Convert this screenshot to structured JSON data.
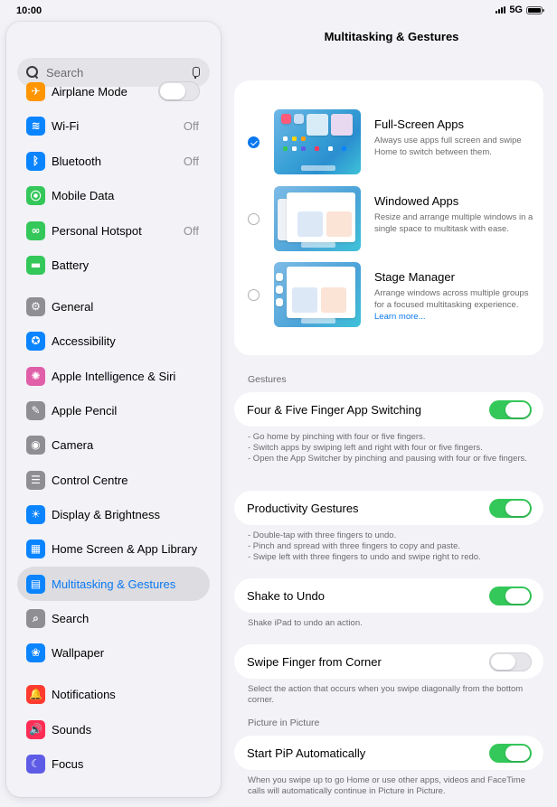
{
  "status_bar": {
    "time": "10:00",
    "network": "5G"
  },
  "sidebar": {
    "search_placeholder": "Search",
    "items": [
      {
        "label": "Airplane Mode",
        "icon": "airplane-icon",
        "color": "#ff9500",
        "glyph": "✈",
        "toggle": false,
        "value": ""
      },
      {
        "label": "Wi-Fi",
        "icon": "wifi-icon",
        "color": "#0a84ff",
        "glyph": "≋",
        "value": "Off"
      },
      {
        "label": "Bluetooth",
        "icon": "bluetooth-icon",
        "color": "#0a84ff",
        "glyph": "ᛒ",
        "value": "Off"
      },
      {
        "label": "Mobile Data",
        "icon": "antenna-icon",
        "color": "#34c759",
        "glyph": "⦿",
        "value": ""
      },
      {
        "label": "Personal Hotspot",
        "icon": "hotspot-icon",
        "color": "#34c759",
        "glyph": "∞",
        "value": "Off"
      },
      {
        "label": "Battery",
        "icon": "battery-icon",
        "color": "#34c759",
        "glyph": "▬",
        "value": ""
      },
      {
        "label": "General",
        "icon": "gear-icon",
        "color": "#8e8e93",
        "glyph": "⚙",
        "value": ""
      },
      {
        "label": "Accessibility",
        "icon": "accessibility-icon",
        "color": "#0a84ff",
        "glyph": "✪",
        "value": ""
      },
      {
        "label": "Apple Intelligence & Siri",
        "icon": "siri-icon",
        "color": "#e05fa8",
        "glyph": "✺",
        "value": ""
      },
      {
        "label": "Apple Pencil",
        "icon": "pencil-icon",
        "color": "#8e8e93",
        "glyph": "✎",
        "value": ""
      },
      {
        "label": "Camera",
        "icon": "camera-icon",
        "color": "#8e8e93",
        "glyph": "◉",
        "value": ""
      },
      {
        "label": "Control Centre",
        "icon": "control-centre-icon",
        "color": "#8e8e93",
        "glyph": "☰",
        "value": ""
      },
      {
        "label": "Display & Brightness",
        "icon": "brightness-icon",
        "color": "#0a84ff",
        "glyph": "☀",
        "value": ""
      },
      {
        "label": "Home Screen & App Library",
        "icon": "home-screen-icon",
        "color": "#0a84ff",
        "glyph": "▦",
        "value": ""
      },
      {
        "label": "Multitasking & Gestures",
        "icon": "multitasking-icon",
        "color": "#0a84ff",
        "glyph": "▤",
        "value": "",
        "active": true
      },
      {
        "label": "Search",
        "icon": "search-icon",
        "color": "#8e8e93",
        "glyph": "⌕",
        "value": ""
      },
      {
        "label": "Wallpaper",
        "icon": "wallpaper-icon",
        "color": "#0a84ff",
        "glyph": "❀",
        "value": ""
      },
      {
        "label": "Notifications",
        "icon": "notifications-icon",
        "color": "#ff3b30",
        "glyph": "🔔",
        "value": ""
      },
      {
        "label": "Sounds",
        "icon": "sounds-icon",
        "color": "#ff2d55",
        "glyph": "🔊",
        "value": ""
      },
      {
        "label": "Focus",
        "icon": "focus-icon",
        "color": "#5e5ce6",
        "glyph": "☾",
        "value": ""
      }
    ]
  },
  "main": {
    "title": "Multitasking & Gestures",
    "modes": [
      {
        "title": "Full-Screen Apps",
        "description": "Always use apps full screen and swipe Home to switch between them.",
        "selected": true
      },
      {
        "title": "Windowed Apps",
        "description": "Resize and arrange multiple windows in a single space to multitask with ease.",
        "selected": false
      },
      {
        "title": "Stage Manager",
        "description": "Arrange windows across multiple groups for a focused multitasking experience.",
        "link": "Learn more...",
        "selected": false
      }
    ],
    "gestures_header": "Gestures",
    "gestures": [
      {
        "label": "Four & Five Finger App Switching",
        "on": true,
        "footnote": [
          "- Go home by pinching with four or five fingers.",
          "- Switch apps by swiping left and right with four or five fingers.",
          "- Open the App Switcher by pinching and pausing with four or five fingers."
        ]
      },
      {
        "label": "Productivity Gestures",
        "on": true,
        "footnote": [
          "- Double-tap with three fingers to undo.",
          "- Pinch and spread with three fingers to copy and paste.",
          "- Swipe left with three fingers to undo and swipe right to redo."
        ]
      },
      {
        "label": "Shake to Undo",
        "on": true,
        "footnote": [
          "Shake iPad to undo an action."
        ]
      },
      {
        "label": "Swipe Finger from Corner",
        "on": false,
        "footnote": [
          "Select the action that occurs when you swipe diagonally from the bottom corner."
        ]
      }
    ],
    "pip_header": "Picture in Picture",
    "pip": {
      "label": "Start PiP Automatically",
      "on": true,
      "footnote": [
        "When you swipe up to go Home or use other apps, videos and FaceTime calls will automatically continue in Picture in Picture."
      ]
    }
  },
  "colors": {
    "accent": "#0a78f0",
    "toggle_on": "#34c759",
    "background": "#f2f2f7"
  }
}
